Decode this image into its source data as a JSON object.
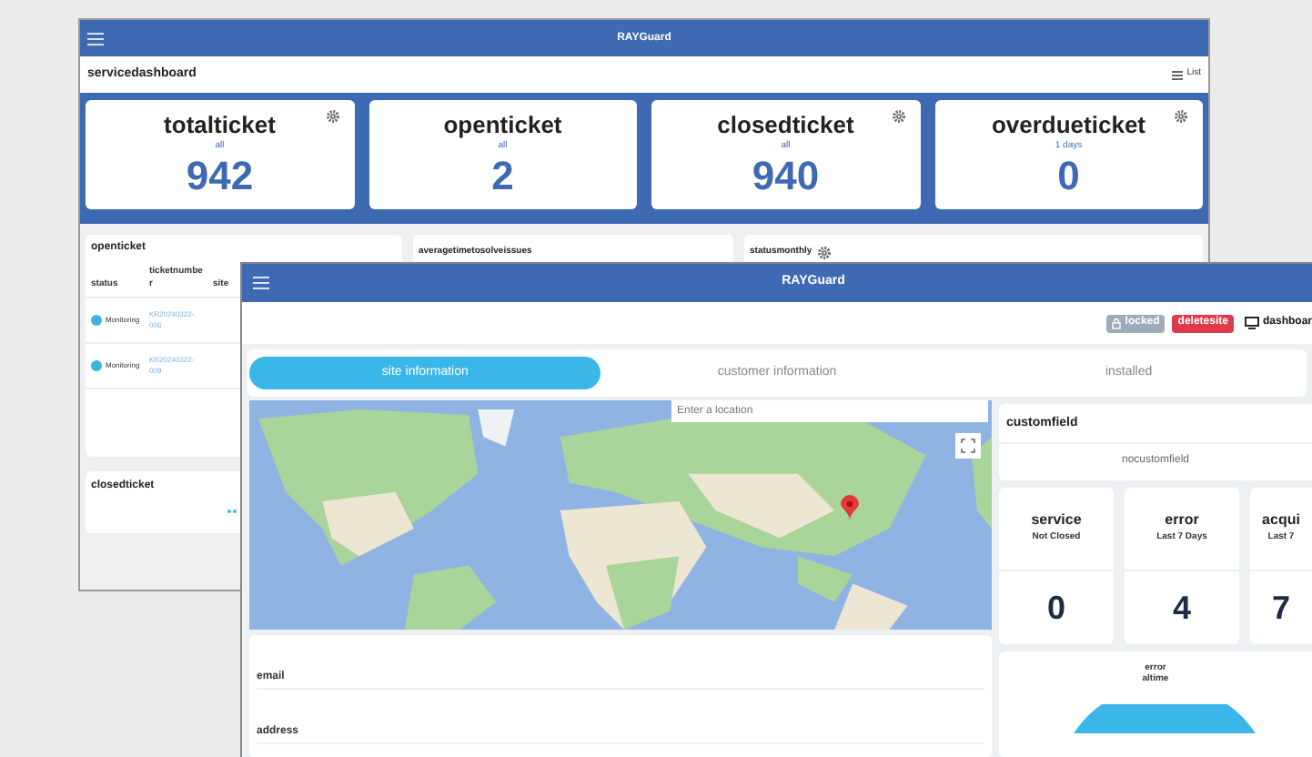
{
  "back_window": {
    "title": "RAYGuard",
    "page_title": "servicedashboard",
    "list_button": "List",
    "cards": [
      {
        "title": "totalticket",
        "subtitle": "all",
        "value": "942",
        "settings_icon": true
      },
      {
        "title": "openticket",
        "subtitle": "all",
        "value": "2",
        "settings_icon": false
      },
      {
        "title": "closedticket",
        "subtitle": "all",
        "value": "940",
        "settings_icon": true
      },
      {
        "title": "overdueticket",
        "subtitle": "1 days",
        "value": "0",
        "settings_icon": true
      }
    ],
    "openticket": {
      "title": "openticket",
      "columns": [
        "status",
        "ticketnumber",
        "site"
      ],
      "rows": [
        {
          "status": "Monitoring",
          "ticket": "KR20240322-006"
        },
        {
          "status": "Monitoring",
          "ticket": "KR20240322-009"
        }
      ]
    },
    "panels": [
      {
        "title": "averagetimetosolveissues",
        "settings_icon": false
      },
      {
        "title": "statusmonthly",
        "settings_icon": true
      }
    ],
    "closedticket": {
      "title": "closedticket"
    }
  },
  "front_window": {
    "title": "RAYGuard",
    "actions": [
      {
        "kind": "locked",
        "label": "locked"
      },
      {
        "kind": "danger",
        "label": "deletesite"
      },
      {
        "kind": "link",
        "label": "dashboar"
      }
    ],
    "tabs": [
      {
        "label": "site information",
        "selected": true
      },
      {
        "label": "customer information",
        "selected": false
      },
      {
        "label": "installed",
        "selected": false
      }
    ],
    "map": {
      "placeholder": "Enter a location"
    },
    "fields": [
      "email",
      "address"
    ],
    "customfield": {
      "title": "customfield",
      "empty_text": "nocustomfield"
    },
    "stats": [
      {
        "title": "service",
        "subtitle": "Not Closed",
        "value": "0"
      },
      {
        "title": "error",
        "subtitle": "Last 7 Days",
        "value": "4"
      },
      {
        "title": "acqui",
        "subtitle": "Last 7",
        "value": "7"
      }
    ],
    "error_chart": {
      "title": "error",
      "subtitle": "altime"
    }
  }
}
